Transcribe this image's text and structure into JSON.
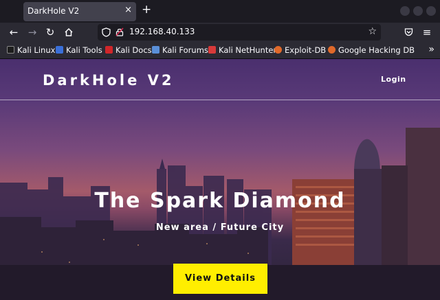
{
  "browser": {
    "tab_title": "DarkHole V2",
    "tab_close": "×",
    "new_tab": "+",
    "url": "192.168.40.133",
    "bookmarks": [
      {
        "label": "Kali Linux",
        "color": "#1d1d1d",
        "icon": "kali-linux-icon"
      },
      {
        "label": "Kali Tools",
        "color": "#3a6fd8",
        "icon": "kali-tools-icon"
      },
      {
        "label": "Kali Docs",
        "color": "#d0262a",
        "icon": "kali-docs-icon"
      },
      {
        "label": "Kali Forums",
        "color": "#5a8fd8",
        "icon": "kali-forums-icon"
      },
      {
        "label": "Kali NetHunter",
        "color": "#d83a3a",
        "icon": "kali-nethunter-icon"
      },
      {
        "label": "Exploit-DB",
        "color": "#e0692a",
        "icon": "exploit-db-icon"
      },
      {
        "label": "Google Hacking DB",
        "color": "#e0692a",
        "icon": "google-hacking-db-icon"
      }
    ],
    "bookmarks_more": "»"
  },
  "site": {
    "brand": "DarkHole V2",
    "login": "Login",
    "hero_title": "The Spark Diamond",
    "hero_subtitle": "New area / Future City",
    "cta": "View Details"
  },
  "colors": {
    "cta_background": "#ffee00",
    "browser_chrome": "#2b2a33",
    "tab_active": "#42414d"
  }
}
